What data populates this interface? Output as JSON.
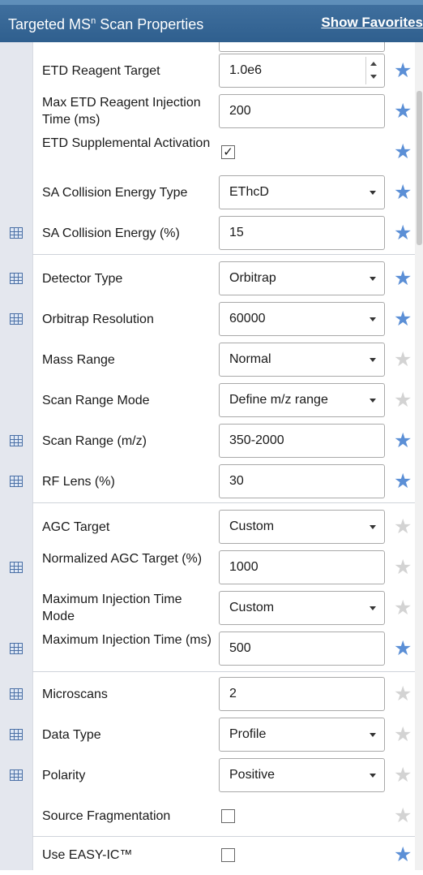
{
  "header": {
    "title_main": "Targeted MS",
    "title_sup": "n",
    "title_rest": " Scan Properties",
    "show_favorites": "Show Favorites"
  },
  "colors": {
    "header_bg": "#2f5f8e",
    "star_on": "#5b8fd6",
    "star_off": "#d3d3d3",
    "gutter": "#e4e7ee"
  },
  "rows": [
    {
      "label": "ETD Reagent Target",
      "control": "spinner",
      "value": "1.0e6",
      "favorite": true,
      "icon": false
    },
    {
      "label": "Max ETD Reagent Injection Time (ms)",
      "control": "text",
      "value": "200",
      "favorite": true,
      "icon": false
    },
    {
      "label": "ETD Supplemental Activation",
      "control": "checkbox",
      "checked": true,
      "check_glyph": "✓",
      "favorite": true,
      "icon": false
    },
    {
      "label": "SA Collision Energy Type",
      "control": "dropdown",
      "value": "EThcD",
      "favorite": true,
      "icon": false
    },
    {
      "label": "SA Collision Energy (%)",
      "control": "text",
      "value": "15",
      "favorite": true,
      "icon": true
    },
    {
      "label": "Detector Type",
      "control": "dropdown",
      "value": "Orbitrap",
      "favorite": true,
      "icon": true
    },
    {
      "label": "Orbitrap Resolution",
      "control": "dropdown",
      "value": "60000",
      "favorite": true,
      "icon": true
    },
    {
      "label": "Mass Range",
      "control": "dropdown",
      "value": "Normal",
      "favorite": false,
      "icon": false
    },
    {
      "label": "Scan Range Mode",
      "control": "dropdown",
      "value": "Define m/z range",
      "favorite": false,
      "icon": false
    },
    {
      "label": "Scan Range (m/z)",
      "control": "text",
      "value": "350-2000",
      "favorite": true,
      "icon": true
    },
    {
      "label": "RF Lens (%)",
      "control": "text",
      "value": "30",
      "favorite": true,
      "icon": true
    },
    {
      "label": "AGC Target",
      "control": "dropdown",
      "value": "Custom",
      "favorite": false,
      "icon": false
    },
    {
      "label": "Normalized AGC Target (%)",
      "control": "text",
      "value": "1000",
      "favorite": false,
      "icon": true
    },
    {
      "label": "Maximum Injection Time Mode",
      "control": "dropdown",
      "value": "Custom",
      "favorite": false,
      "icon": false
    },
    {
      "label": "Maximum Injection Time (ms)",
      "control": "text",
      "value": "500",
      "favorite": true,
      "icon": true
    },
    {
      "label": "Microscans",
      "control": "text",
      "value": "2",
      "favorite": false,
      "icon": true
    },
    {
      "label": "Data Type",
      "control": "dropdown",
      "value": "Profile",
      "favorite": false,
      "icon": true
    },
    {
      "label": "Polarity",
      "control": "dropdown",
      "value": "Positive",
      "favorite": false,
      "icon": true
    },
    {
      "label": "Source Fragmentation",
      "control": "checkbox",
      "checked": false,
      "check_glyph": "",
      "favorite": false,
      "icon": false
    },
    {
      "label": "Use EASY-IC™",
      "control": "checkbox",
      "checked": false,
      "check_glyph": "",
      "favorite": true,
      "icon": false
    }
  ],
  "star_glyph": "★"
}
